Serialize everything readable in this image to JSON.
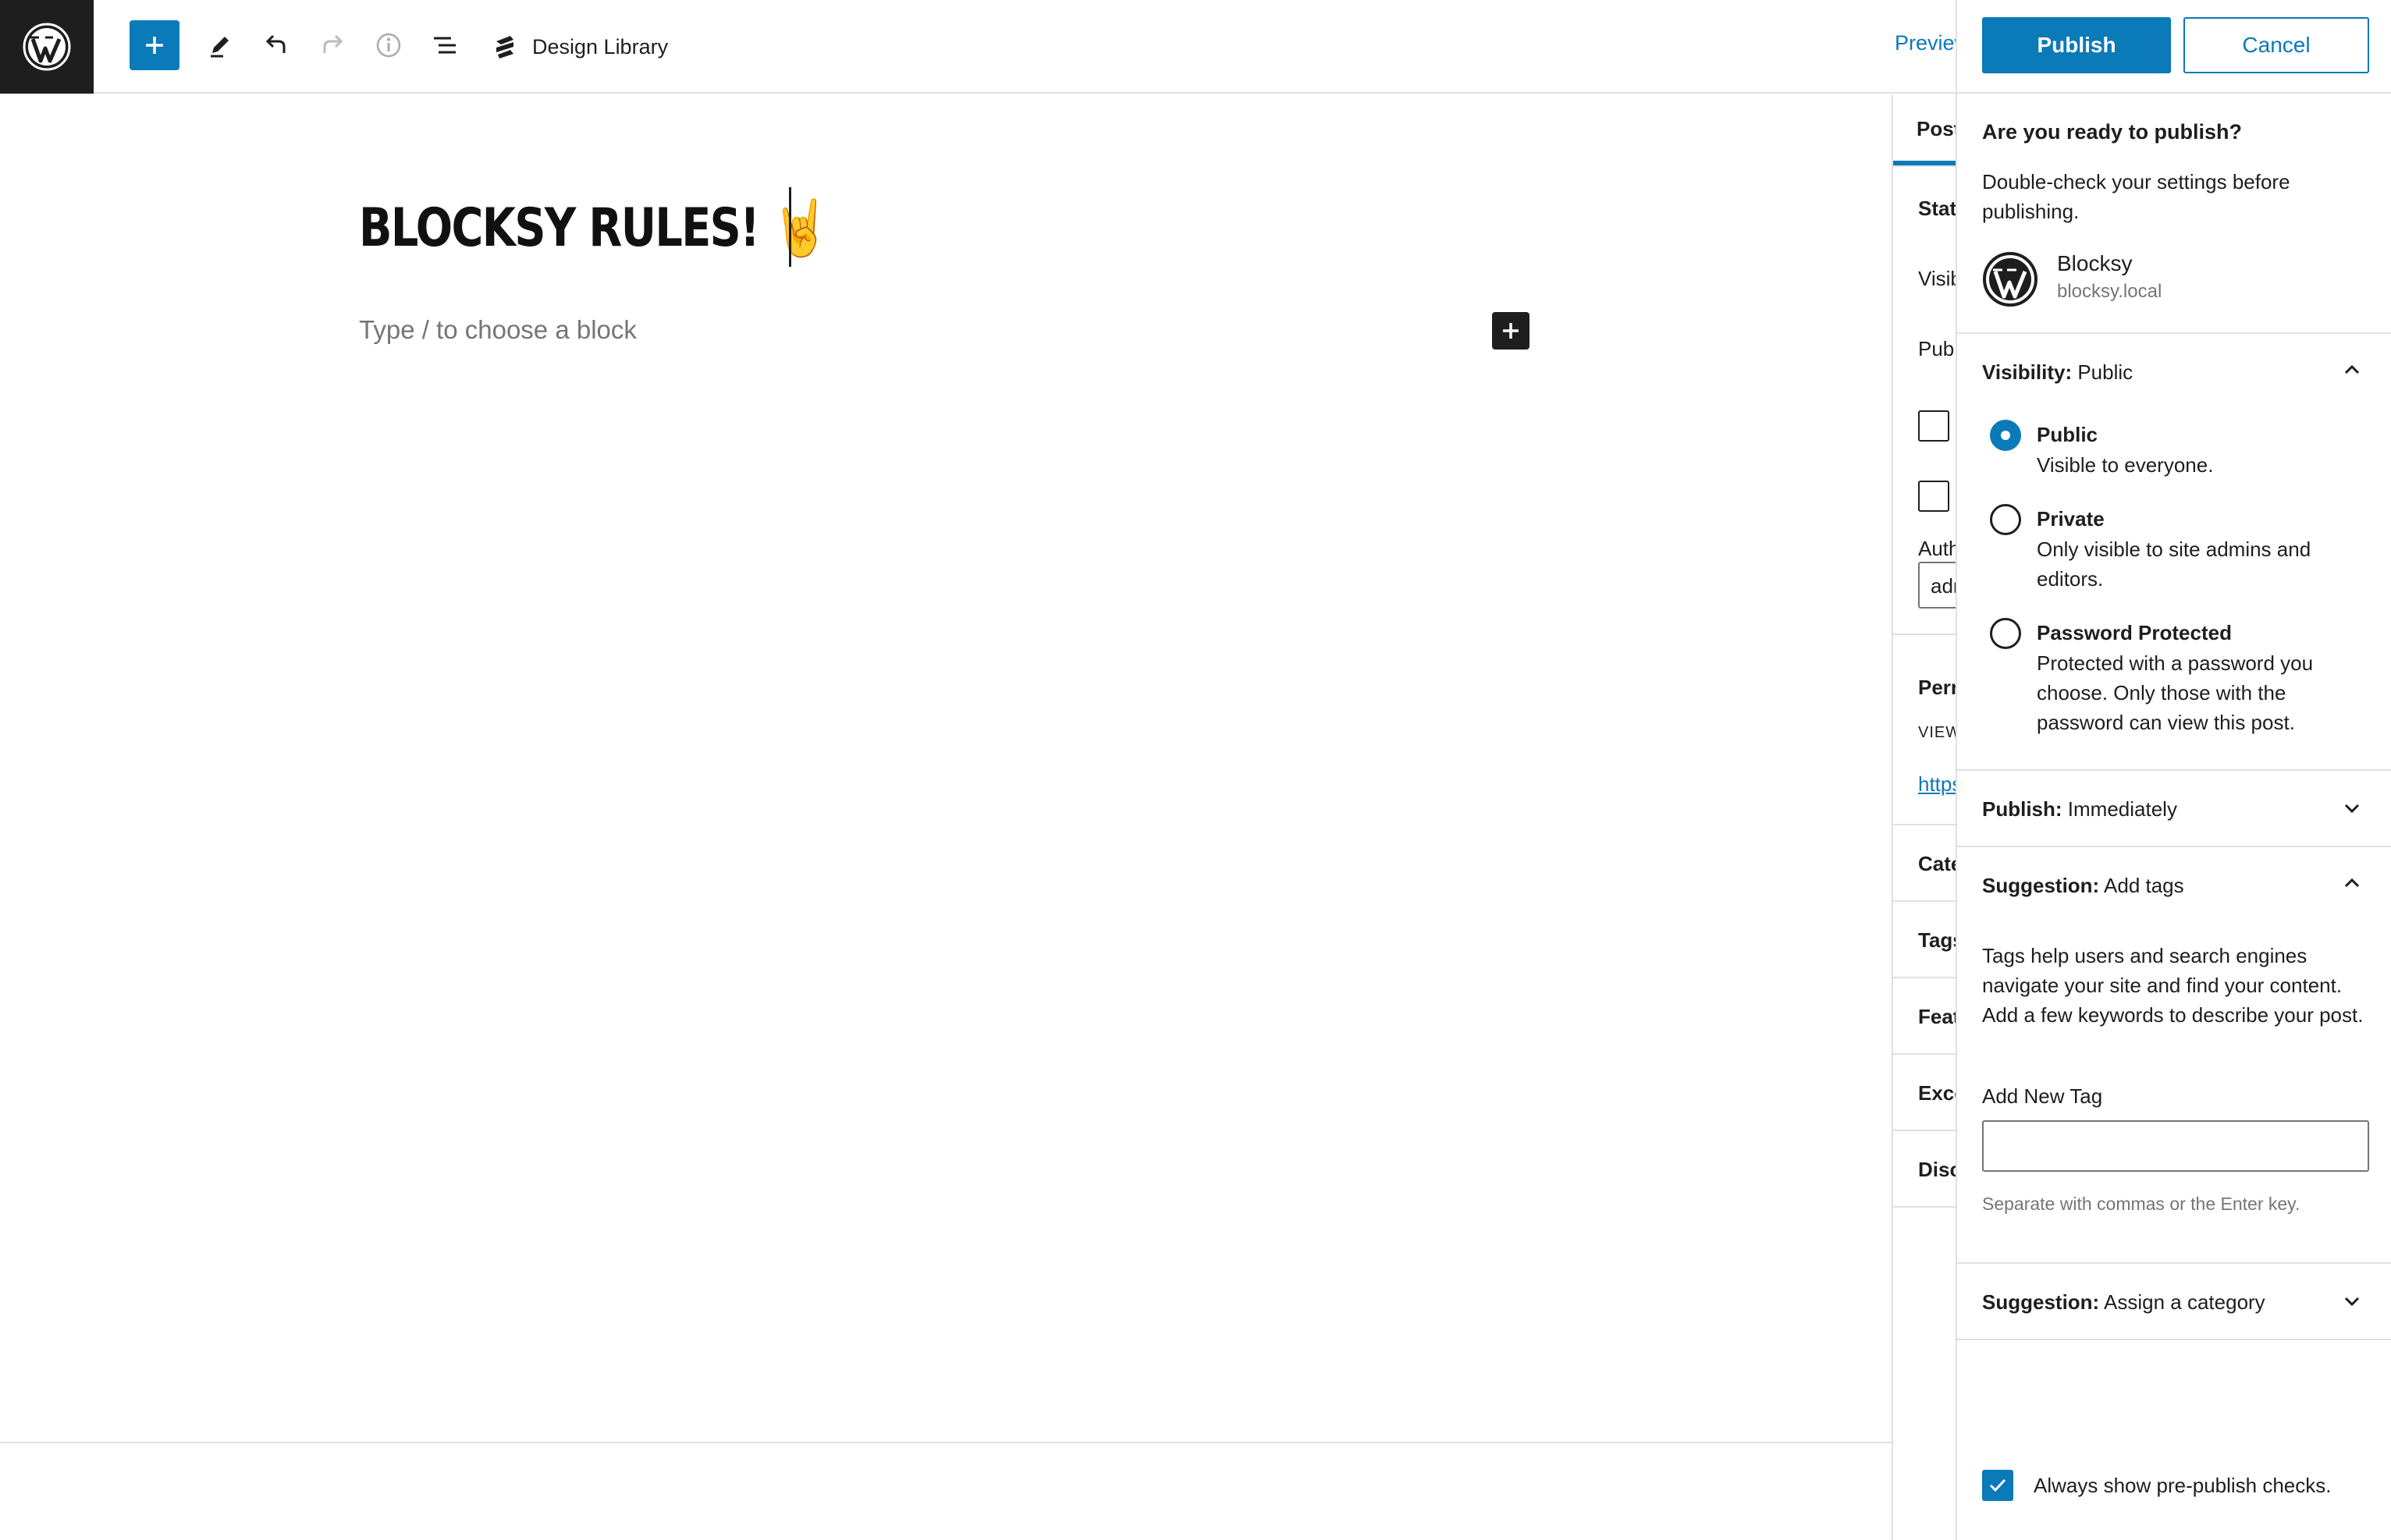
{
  "toolbar": {
    "design_library_label": "Design Library",
    "preview_label": "Preview"
  },
  "editor": {
    "post_title": "BLOCKSY RULES!",
    "title_emoji": "🤘",
    "block_placeholder": "Type / to choose a block"
  },
  "settings_sidebar": {
    "tab_post": "Post",
    "status_label": "Status",
    "visibility_label": "Visibility",
    "publish_label": "Publish",
    "author_label": "Author",
    "author_value": "admin",
    "permalink_label": "Permalink",
    "view_post_label": "VIEW POST",
    "permalink_url": "https://",
    "categories_label": "Categories",
    "tags_label": "Tags",
    "featured_image_label": "Featured image",
    "excerpt_label": "Excerpt",
    "discussion_label": "Discussion"
  },
  "prepublish": {
    "publish_button": "Publish",
    "cancel_button": "Cancel",
    "ready_title": "Are you ready to publish?",
    "double_check": "Double-check your settings before publishing.",
    "site_name": "Blocksy",
    "site_url": "blocksy.local",
    "visibility": {
      "label": "Visibility:",
      "value": "Public",
      "options": [
        {
          "title": "Public",
          "desc": "Visible to everyone.",
          "selected": true
        },
        {
          "title": "Private",
          "desc": "Only visible to site admins and editors.",
          "selected": false
        },
        {
          "title": "Password Protected",
          "desc": "Protected with a password you choose. Only those with the password can view this post.",
          "selected": false
        }
      ]
    },
    "publish_time": {
      "label": "Publish:",
      "value": "Immediately"
    },
    "tags_suggestion": {
      "label": "Suggestion:",
      "value": "Add tags",
      "help": "Tags help users and search engines navigate your site and find your content. Add a few keywords to describe your post.",
      "field_label": "Add New Tag",
      "field_value": "",
      "hint": "Separate with commas or the Enter key."
    },
    "category_suggestion": {
      "label": "Suggestion:",
      "value": "Assign a category"
    },
    "always_show_label": "Always show pre-publish checks."
  },
  "colors": {
    "accent": "#0a7ab8",
    "dark": "#1e1e1e",
    "muted": "#757575",
    "border": "#e0e0e0"
  }
}
